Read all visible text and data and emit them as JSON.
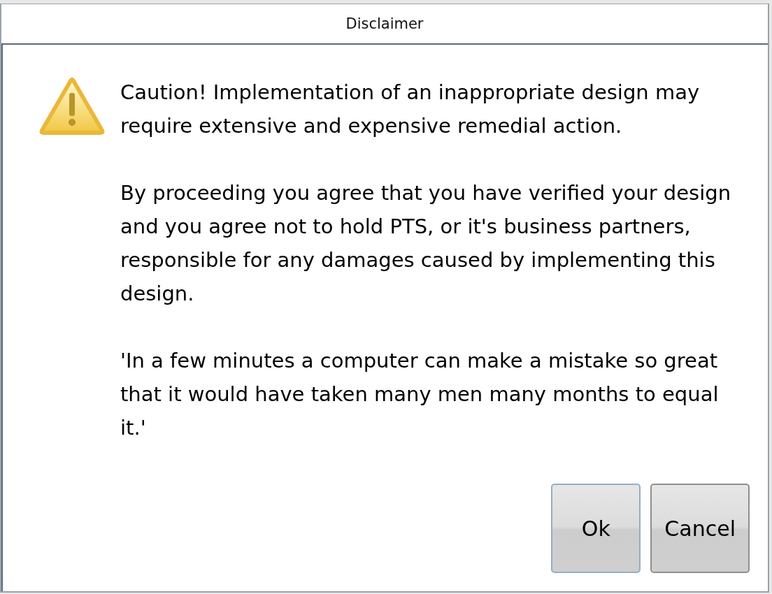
{
  "window": {
    "title": "Disclaimer"
  },
  "message": {
    "paragraphs": [
      "Caution! Implementation of an inappropriate design may require extensive and expensive remedial action.",
      "By proceeding you agree that you have verified your design and you agree not to hold PTS, or it's business partners, responsible for any damages caused by implementing this design.",
      "'In a few minutes a computer can make a mistake so great that it would have taken many men many months to equal it.'"
    ]
  },
  "buttons": [
    {
      "label": "Ok",
      "default": true
    },
    {
      "label": "Cancel",
      "default": false
    }
  ]
}
